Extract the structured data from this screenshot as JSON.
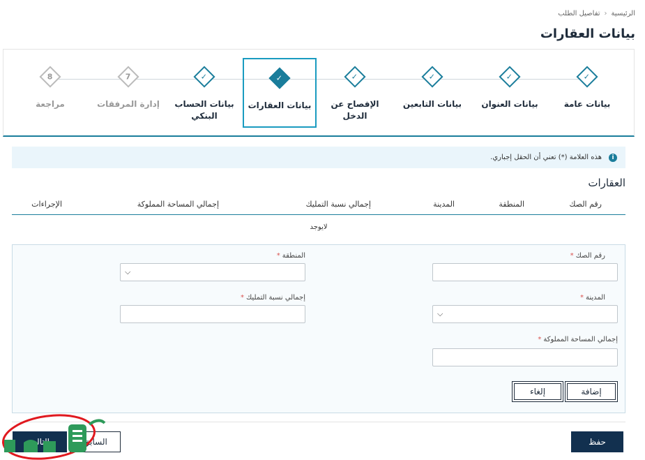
{
  "breadcrumb": {
    "home": "الرئيسية",
    "current": "تفاصيل الطلب"
  },
  "page_title": "بيانات العقارات",
  "steps": [
    {
      "label": "بيانات عامة",
      "marker": "✓",
      "state": "done"
    },
    {
      "label": "بيانات العنوان",
      "marker": "✓",
      "state": "done"
    },
    {
      "label": "بيانات التابعين",
      "marker": "✓",
      "state": "done"
    },
    {
      "label": "الإفصاح عن الدخل",
      "marker": "✓",
      "state": "done"
    },
    {
      "label": "بيانات العقارات",
      "marker": "✓",
      "state": "active"
    },
    {
      "label": "بيانات الحساب البنكي",
      "marker": "✓",
      "state": "done"
    },
    {
      "label": "إدارة المرفقات",
      "marker": "7",
      "state": "pending"
    },
    {
      "label": "مراجعة",
      "marker": "8",
      "state": "pending"
    }
  ],
  "info": {
    "icon": "info-icon",
    "text": "هذه العلامة (*) تعني أن الحقل إجباري."
  },
  "section_title": "العقارات",
  "table": {
    "headers": [
      "رقم الصك",
      "المنطقة",
      "المدينة",
      "إجمالي نسبة التمليك",
      "إجمالي المساحة المملوكة",
      "الإجراءات"
    ],
    "empty_text": "لايوجد"
  },
  "form": {
    "deed_number_label": "رقم الصك",
    "region_label": "المنطقة",
    "city_label": "المدينة",
    "ownership_ratio_label": "إجمالي نسبة التمليك",
    "owned_area_label": "إجمالي المساحة المملوكة",
    "required_mark": "*",
    "add_label": "إضافة",
    "cancel_label": "إلغاء"
  },
  "footer": {
    "save_label": "حفظ",
    "previous_label": "السابق",
    "next_label": "التالي"
  },
  "colors": {
    "primary": "#12304f",
    "accent": "#1a7d9b",
    "info_bg": "#eaf5fb",
    "watermark_green": "#2e9a5a",
    "watermark_ring": "#e0191f"
  }
}
